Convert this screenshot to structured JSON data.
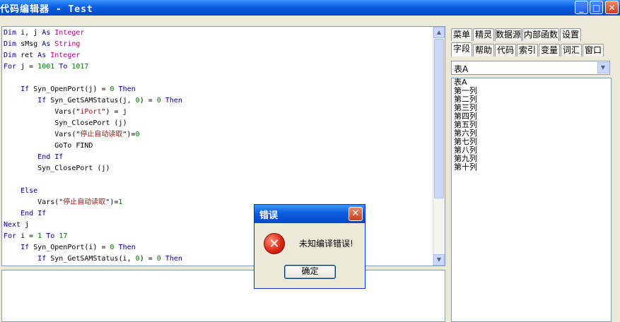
{
  "window": {
    "title": "代码编辑器 - Test"
  },
  "code_lines": [
    [
      {
        "t": "Dim",
        "c": "kw"
      },
      {
        "t": " i, j "
      },
      {
        "t": "As",
        "c": "kw"
      },
      {
        "t": " "
      },
      {
        "t": "Integer",
        "c": "ty"
      }
    ],
    [
      {
        "t": "Dim",
        "c": "kw"
      },
      {
        "t": " sMsg "
      },
      {
        "t": "As",
        "c": "kw"
      },
      {
        "t": " "
      },
      {
        "t": "String",
        "c": "ty"
      }
    ],
    [
      {
        "t": "Dim",
        "c": "kw"
      },
      {
        "t": " ret "
      },
      {
        "t": "As",
        "c": "kw"
      },
      {
        "t": " "
      },
      {
        "t": "Integer",
        "c": "ty"
      }
    ],
    [
      {
        "t": "For",
        "c": "kw"
      },
      {
        "t": " j = "
      },
      {
        "t": "1001",
        "c": "num"
      },
      {
        "t": " "
      },
      {
        "t": "To",
        "c": "kw"
      },
      {
        "t": " "
      },
      {
        "t": "1017",
        "c": "num"
      }
    ],
    [],
    [
      {
        "t": "    "
      },
      {
        "t": "If",
        "c": "kw"
      },
      {
        "t": " Syn_OpenPort(j) = "
      },
      {
        "t": "0",
        "c": "num"
      },
      {
        "t": " "
      },
      {
        "t": "Then",
        "c": "kw"
      }
    ],
    [
      {
        "t": "        "
      },
      {
        "t": "If",
        "c": "kw"
      },
      {
        "t": " Syn_GetSAMStatus(j, "
      },
      {
        "t": "0",
        "c": "num"
      },
      {
        "t": ") = "
      },
      {
        "t": "0",
        "c": "num"
      },
      {
        "t": " "
      },
      {
        "t": "Then",
        "c": "kw"
      }
    ],
    [
      {
        "t": "            Vars(\""
      },
      {
        "t": "iPort",
        "c": "str"
      },
      {
        "t": "\") = j"
      }
    ],
    [
      {
        "t": "            Syn_ClosePort (j)"
      }
    ],
    [
      {
        "t": "            Vars(\""
      },
      {
        "t": "停止自动读取",
        "c": "str"
      },
      {
        "t": "\")="
      },
      {
        "t": "0",
        "c": "num"
      }
    ],
    [
      {
        "t": "            GoTo FIND"
      }
    ],
    [
      {
        "t": "        "
      },
      {
        "t": "End",
        "c": "kw"
      },
      {
        "t": " "
      },
      {
        "t": "If",
        "c": "kw"
      }
    ],
    [
      {
        "t": "        Syn_ClosePort (j)"
      }
    ],
    [],
    [
      {
        "t": "    "
      },
      {
        "t": "Else",
        "c": "kw"
      }
    ],
    [
      {
        "t": "        Vars(\""
      },
      {
        "t": "停止自动读取",
        "c": "str"
      },
      {
        "t": "\")="
      },
      {
        "t": "1",
        "c": "num"
      }
    ],
    [
      {
        "t": "    "
      },
      {
        "t": "End",
        "c": "kw"
      },
      {
        "t": " "
      },
      {
        "t": "If",
        "c": "kw"
      }
    ],
    [
      {
        "t": "Next",
        "c": "kw"
      },
      {
        "t": " j"
      }
    ],
    [
      {
        "t": "For",
        "c": "kw"
      },
      {
        "t": " i = "
      },
      {
        "t": "1",
        "c": "num"
      },
      {
        "t": " "
      },
      {
        "t": "To",
        "c": "kw"
      },
      {
        "t": " "
      },
      {
        "t": "17",
        "c": "num"
      }
    ],
    [
      {
        "t": "    "
      },
      {
        "t": "If",
        "c": "kw"
      },
      {
        "t": " Syn_OpenPort(i) = "
      },
      {
        "t": "0",
        "c": "num"
      },
      {
        "t": " "
      },
      {
        "t": "Then",
        "c": "kw"
      }
    ],
    [
      {
        "t": "        "
      },
      {
        "t": "If",
        "c": "kw"
      },
      {
        "t": " Syn_GetSAMStatus(i, "
      },
      {
        "t": "0",
        "c": "num"
      },
      {
        "t": ") = "
      },
      {
        "t": "0",
        "c": "num"
      },
      {
        "t": " "
      },
      {
        "t": "Then",
        "c": "kw"
      }
    ]
  ],
  "tabs_row1": [
    "菜单",
    "精灵",
    "数据源",
    "内部函数",
    "设置"
  ],
  "tabs_row2": [
    "字段",
    "帮助",
    "代码",
    "索引",
    "变量",
    "词汇",
    "窗口"
  ],
  "active_tab": "字段",
  "table_select": {
    "value": "表A"
  },
  "field_list": [
    "表A",
    "第一列",
    "第二列",
    "第三列",
    "第四列",
    "第五列",
    "第六列",
    "第七列",
    "第八列",
    "第九列",
    "第十列"
  ],
  "dialog": {
    "title": "错误",
    "message": "未知编译错误!",
    "ok_label": "确定"
  },
  "icons": {
    "error": "error-x-icon",
    "minimize": "minimize-icon",
    "maximize": "maximize-icon",
    "close": "close-icon"
  }
}
